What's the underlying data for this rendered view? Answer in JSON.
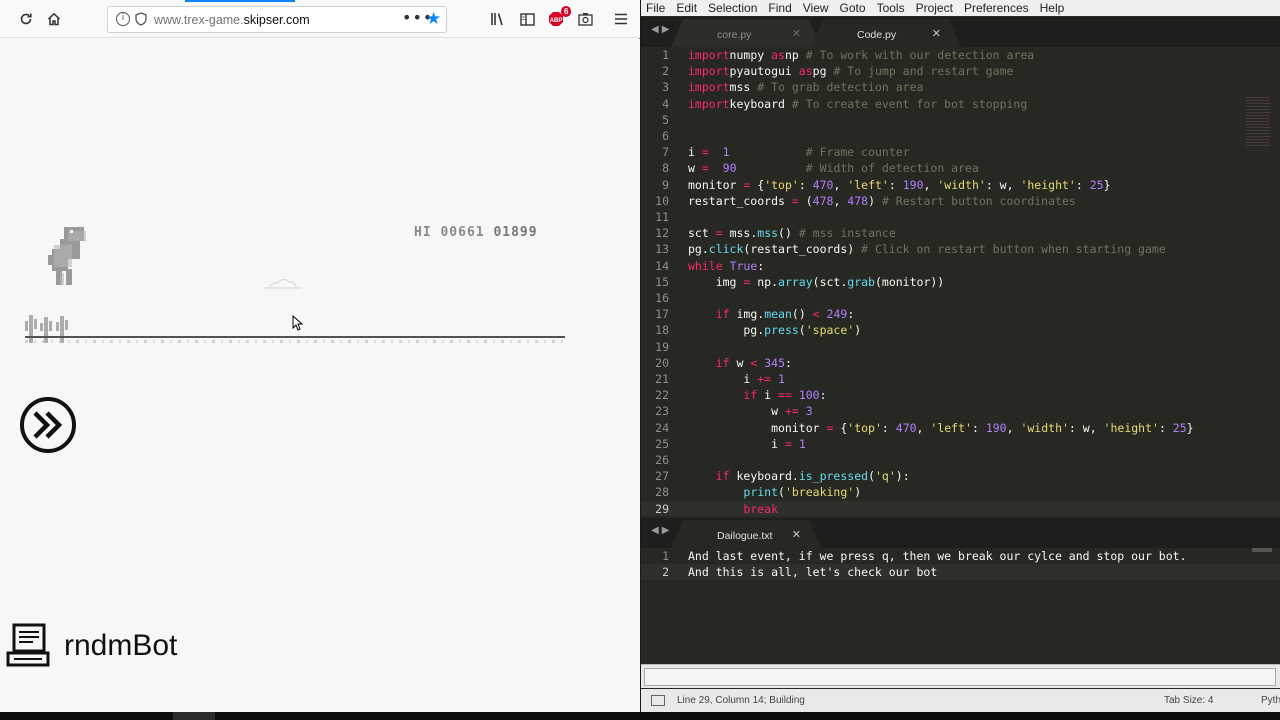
{
  "browser": {
    "url_prefix": "www.trex-game.",
    "url_domain": "skipser.com",
    "badge_count": "6",
    "icons": [
      "reload-icon",
      "home-icon",
      "info-icon",
      "shield-icon",
      "more-icon",
      "bookmark-star-icon",
      "library-icon",
      "sidebar-icon",
      "adblock-icon",
      "screenshot-icon",
      "hamburger-menu-icon"
    ]
  },
  "game": {
    "hi_label": "HI",
    "hi_score": "00661",
    "score": "01899"
  },
  "channel": {
    "name": "rndmBot"
  },
  "editor": {
    "menu": [
      "File",
      "Edit",
      "Selection",
      "Find",
      "View",
      "Goto",
      "Tools",
      "Project",
      "Preferences",
      "Help"
    ],
    "tabs_top": [
      {
        "label": "core.py",
        "active": false
      },
      {
        "label": "Code.py",
        "active": true
      }
    ],
    "tabs_bottom": [
      {
        "label": "Dailogue.txt",
        "active": true
      }
    ],
    "code_lines": [
      [
        [
          "kw",
          "import"
        ],
        [
          "",
          "numpy "
        ],
        [
          "kw",
          "as"
        ],
        [
          "",
          "np "
        ],
        [
          "cm",
          "# To work with our detection area"
        ]
      ],
      [
        [
          "kw",
          "import"
        ],
        [
          "",
          "pyautogui "
        ],
        [
          "kw",
          "as"
        ],
        [
          "",
          "pg "
        ],
        [
          "cm",
          "# To jump and restart game"
        ]
      ],
      [
        [
          "kw",
          "import"
        ],
        [
          "",
          "mss "
        ],
        [
          "cm",
          "# To grab detection area"
        ]
      ],
      [
        [
          "kw",
          "import"
        ],
        [
          "",
          "keyboard "
        ],
        [
          "cm",
          "# To create event for bot stopping"
        ]
      ],
      [],
      [],
      [
        [
          "",
          "i "
        ],
        [
          "kw",
          "="
        ],
        [
          "",
          "  "
        ],
        [
          "num",
          "1"
        ],
        [
          "",
          "           "
        ],
        [
          "cm",
          "# Frame counter"
        ]
      ],
      [
        [
          "",
          "w "
        ],
        [
          "kw",
          "="
        ],
        [
          "",
          "  "
        ],
        [
          "num",
          "90"
        ],
        [
          "",
          "          "
        ],
        [
          "cm",
          "# Width of detection area"
        ]
      ],
      [
        [
          "",
          "monitor "
        ],
        [
          "kw",
          "="
        ],
        [
          "",
          " {"
        ],
        [
          "str",
          "'top'"
        ],
        [
          ": "
        ],
        [
          "num",
          "470"
        ],
        [
          ", "
        ],
        [
          "str",
          "'left'"
        ],
        [
          ": "
        ],
        [
          "num",
          "190"
        ],
        [
          ", "
        ],
        [
          "str",
          "'width'"
        ],
        [
          ": w, "
        ],
        [
          "str",
          "'height'"
        ],
        [
          ": "
        ],
        [
          "num",
          "25"
        ],
        [
          "",
          "}"
        ]
      ],
      [
        [
          "",
          "restart_coords "
        ],
        [
          "kw",
          "="
        ],
        [
          "",
          " ("
        ],
        [
          "num",
          "478"
        ],
        [
          ", "
        ],
        [
          "num",
          "478"
        ],
        [
          "",
          ") "
        ],
        [
          "cm",
          "# Restart button coordinates"
        ]
      ],
      [],
      [
        [
          "",
          "sct "
        ],
        [
          "kw",
          "="
        ],
        [
          "",
          " mss."
        ],
        [
          "fn",
          "mss"
        ],
        [
          "",
          "() "
        ],
        [
          "cm",
          "# mss instance"
        ]
      ],
      [
        [
          "",
          "pg."
        ],
        [
          "fn",
          "click"
        ],
        [
          "",
          "(restart_coords) "
        ],
        [
          "cm",
          "# Click on restart button when starting game"
        ]
      ],
      [
        [
          "kw",
          "while"
        ],
        [
          "",
          " "
        ],
        [
          "num",
          "True"
        ],
        [
          "",
          ":"
        ]
      ],
      [
        [
          "",
          "    img "
        ],
        [
          "kw",
          "="
        ],
        [
          "",
          " np."
        ],
        [
          "fn",
          "array"
        ],
        [
          "",
          "(sct."
        ],
        [
          "fn",
          "grab"
        ],
        [
          "",
          "(monitor))"
        ]
      ],
      [],
      [
        [
          "",
          "    "
        ],
        [
          "kw",
          "if"
        ],
        [
          "",
          " img."
        ],
        [
          "fn",
          "mean"
        ],
        [
          "",
          "() "
        ],
        [
          "kw",
          "<"
        ],
        [
          "",
          " "
        ],
        [
          "num",
          "249"
        ],
        [
          "",
          ":"
        ]
      ],
      [
        [
          "",
          "        pg."
        ],
        [
          "fn",
          "press"
        ],
        [
          "",
          "("
        ],
        [
          "str",
          "'space'"
        ],
        [
          "",
          ")"
        ]
      ],
      [],
      [
        [
          "",
          "    "
        ],
        [
          "kw",
          "if"
        ],
        [
          "",
          " w "
        ],
        [
          "kw",
          "<"
        ],
        [
          "",
          " "
        ],
        [
          "num",
          "345"
        ],
        [
          "",
          ":"
        ]
      ],
      [
        [
          "",
          "        i "
        ],
        [
          "kw",
          "+="
        ],
        [
          "",
          " "
        ],
        [
          "num",
          "1"
        ]
      ],
      [
        [
          "",
          "        "
        ],
        [
          "kw",
          "if"
        ],
        [
          "",
          " i "
        ],
        [
          "kw",
          "=="
        ],
        [
          "",
          " "
        ],
        [
          "num",
          "100"
        ],
        [
          "",
          ":"
        ]
      ],
      [
        [
          "",
          "            w "
        ],
        [
          "kw",
          "+="
        ],
        [
          "",
          " "
        ],
        [
          "num",
          "3"
        ]
      ],
      [
        [
          "",
          "            monitor "
        ],
        [
          "kw",
          "="
        ],
        [
          "",
          " {"
        ],
        [
          "str",
          "'top'"
        ],
        [
          "",
          ": "
        ],
        [
          "num",
          "470"
        ],
        [
          "",
          ", "
        ],
        [
          "str",
          "'left'"
        ],
        [
          "",
          ": "
        ],
        [
          "num",
          "190"
        ],
        [
          "",
          ", "
        ],
        [
          "str",
          "'width'"
        ],
        [
          "",
          ": w, "
        ],
        [
          "str",
          "'height'"
        ],
        [
          "",
          ": "
        ],
        [
          "num",
          "25"
        ],
        [
          "",
          "}"
        ]
      ],
      [
        [
          "",
          "            i "
        ],
        [
          "kw",
          "="
        ],
        [
          "",
          " "
        ],
        [
          "num",
          "1"
        ]
      ],
      [],
      [
        [
          "",
          "    "
        ],
        [
          "kw",
          "if"
        ],
        [
          "",
          " keyboard."
        ],
        [
          "fn",
          "is_pressed"
        ],
        [
          "",
          "("
        ],
        [
          "str",
          "'q'"
        ],
        [
          "",
          "):"
        ]
      ],
      [
        [
          "",
          "        "
        ],
        [
          "fn",
          "print"
        ],
        [
          "",
          "("
        ],
        [
          "str",
          "'breaking'"
        ],
        [
          "",
          ")"
        ]
      ],
      [
        [
          "",
          "        "
        ],
        [
          "kw",
          "break"
        ]
      ]
    ],
    "dialogue_lines": [
      "And last event, if we press q, then we break our cylce and stop our bot.",
      "And this is all, let's check our bot"
    ],
    "status": {
      "position": "Line 29, Column 14; Building",
      "tab_size": "Tab Size: 4",
      "syntax": "Python"
    }
  }
}
